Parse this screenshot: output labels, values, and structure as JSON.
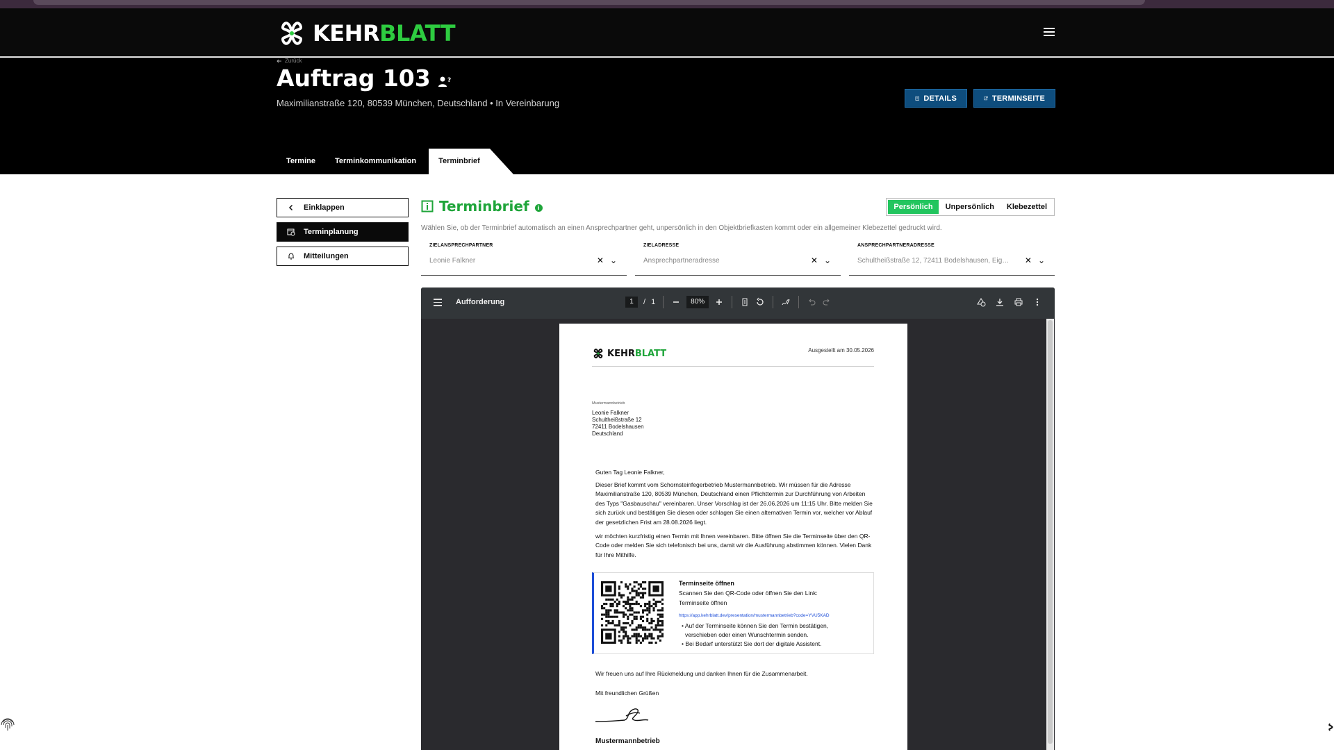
{
  "brand": {
    "name_white": "KEHR",
    "name_green": "BLATT",
    "green": "#2ecc40",
    "dark": "#0a0a0a",
    "blue": "#0e4d7d"
  },
  "header": {
    "back_label": "Zurück",
    "title": "Auftrag 103",
    "subtitle": "Maximilianstraße 120, 80539 München, Deutschland • In Vereinbarung",
    "details_label": "DETAILS",
    "terminseite_label": "TERMINSEITE"
  },
  "tabs": [
    {
      "label": "Termine"
    },
    {
      "label": "Terminkommunikation"
    },
    {
      "label": "Terminbrief"
    }
  ],
  "sidebar": {
    "items": [
      {
        "label": "Einklappen",
        "icon": "chevron-left-icon"
      },
      {
        "label": "Terminplanung",
        "icon": "calendar-clock-icon"
      },
      {
        "label": "Mitteilungen",
        "icon": "bell-icon"
      }
    ]
  },
  "section": {
    "title": "Terminbrief",
    "description": "Wählen Sie, ob der Terminbrief automatisch an einen Ansprechpartner geht, unpersönlich in den Objektbriefkasten kommt oder ein allgemeiner Klebezettel gedruckt wird.",
    "modes": [
      {
        "label": "Persönlich",
        "active": true
      },
      {
        "label": "Unpersönlich",
        "active": false
      },
      {
        "label": "Klebezettel",
        "active": false
      }
    ]
  },
  "fields": [
    {
      "label": "ZIELANSPRECHPARTNER",
      "value": "Leonie Falkner"
    },
    {
      "label": "ZIELADRESSE",
      "value": "Ansprechpartneradresse"
    },
    {
      "label": "ANSPRECHPARTNERADRESSE",
      "value": "Schultheißstraße 12, 72411 Bodelshausen, Eige..."
    }
  ],
  "pdf": {
    "filename": "Aufforderung",
    "page_current": "1",
    "page_sep": "/",
    "page_total": "1",
    "zoom": "80%",
    "letter": {
      "logo_white": "KEHR",
      "logo_green": "BLATT",
      "issued": "Ausgestellt am 30.05.2026",
      "sender_line": "Mustermannbetrieb",
      "recipient": [
        "Leonie Falkner",
        "Schultheißstraße 12",
        "72411 Bodelshausen",
        "Deutschland"
      ],
      "greeting": "Guten Tag Leonie Falkner,",
      "body1": "Dieser Brief kommt vom Schornsteinfegerbetrieb Mustermannbetrieb. Wir müssen für die Adresse Maximilianstraße 120, 80539 München, Deutschland einen Pflichttermin zur Durchführung von Arbeiten des Typs \"Gasbauschau\" vereinbaren. Unser Vorschlag ist der 26.06.2026 um 11:15 Uhr. Bitte melden Sie sich zurück und bestätigen Sie diesen oder schlagen Sie einen alternativen Termin vor, welcher vor Ablauf der gesetzlichen Frist am 28.08.2026 liegt.",
      "body2": "wir möchten kurzfristig einen Termin mit Ihnen vereinbaren. Bitte öffnen Sie die Terminseite über den QR-Code oder melden Sie sich telefonisch bei uns, damit wir die Ausführung abstimmen können. Vielen Dank für Ihre Mithilfe.",
      "box_title": "Terminseite öffnen",
      "box_line1": "Scannen Sie den QR-Code oder öffnen Sie den Link:",
      "box_line2": "Terminseite öffnen",
      "box_link": "https://app.kehrblatt.dev/presentation/mustermannbetrieb?code=YVU5KAD",
      "box_bullet1": "• Auf der Terminseite können Sie den Termin bestätigen,",
      "box_bullet1b": "verschieben oder einen Wunschtermin senden.",
      "box_bullet2": "• Bei Bedarf unterstützt Sie dort der digitale Assistent.",
      "closing1": "Wir freuen uns auf Ihre Rückmeldung und danken Ihnen für die Zusammenarbeit.",
      "closing2": "Mit freundlichen Grüßen",
      "company": "Mustermannbetrieb"
    }
  }
}
